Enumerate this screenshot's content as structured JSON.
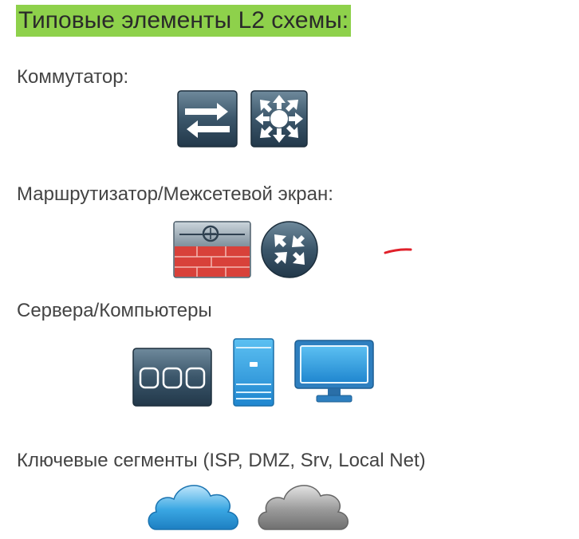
{
  "title": "Типовые элементы L2 схемы:",
  "sections": [
    {
      "label": "Коммутатор:",
      "icons": [
        "switch-icon",
        "multilayer-switch-icon"
      ]
    },
    {
      "label": "Маршрутизатор/Межсетевой экран:",
      "icons": [
        "firewall-icon",
        "router-icon"
      ]
    },
    {
      "label": "Сервера/Компьютеры",
      "icons": [
        "storage-server-icon",
        "tower-server-icon",
        "monitor-icon"
      ]
    },
    {
      "label": "Ключевые сегменты (ISP, DMZ, Srv, Local Net)",
      "icons": [
        "blue-cloud-icon",
        "gray-cloud-icon"
      ]
    }
  ],
  "colors": {
    "title_highlight": "#8ed14b",
    "device_dark": "#2f4a5e",
    "firewall_red": "#d8413a",
    "device_blue": "#2e9be0",
    "cloud_blue": "#2c9ad9",
    "cloud_gray": "#8a8a8a",
    "pen_mark": "#e0202a"
  }
}
